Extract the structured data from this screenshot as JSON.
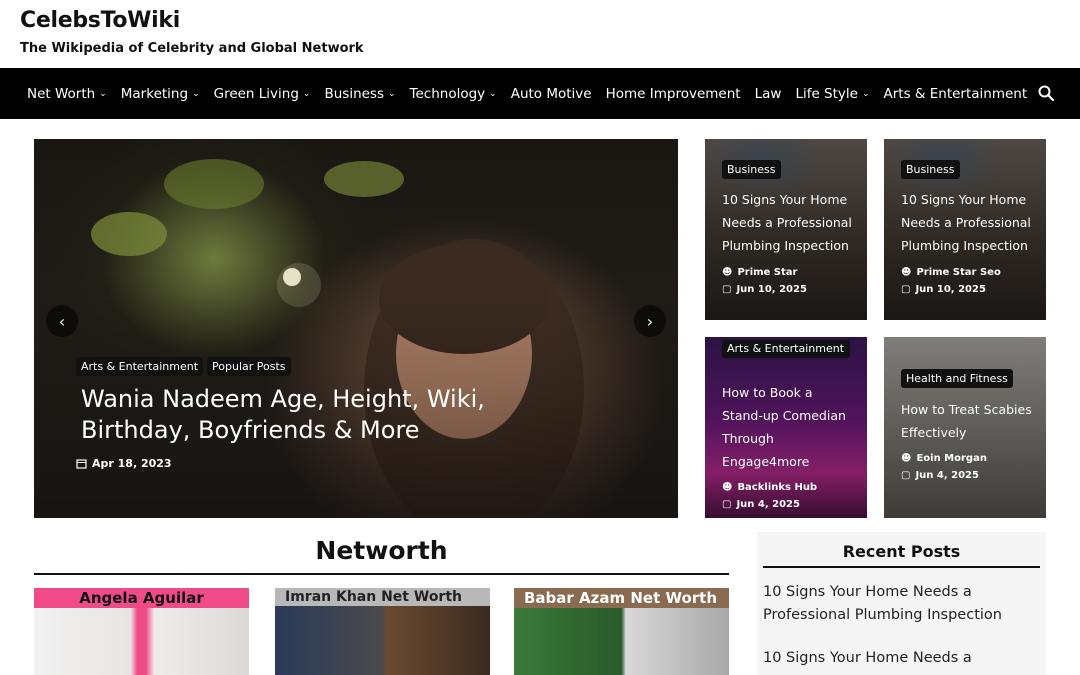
{
  "site": {
    "title": "CelebsToWiki",
    "tagline": "The Wikipedia of Celebrity and Global Network"
  },
  "nav": {
    "items": [
      {
        "label": "Net Worth",
        "dropdown": true
      },
      {
        "label": "Marketing",
        "dropdown": true
      },
      {
        "label": "Green Living",
        "dropdown": true
      },
      {
        "label": "Business",
        "dropdown": true
      },
      {
        "label": "Technology",
        "dropdown": true
      },
      {
        "label": "Auto Motive",
        "dropdown": false
      },
      {
        "label": "Home Improvement",
        "dropdown": false
      },
      {
        "label": "Law",
        "dropdown": false
      },
      {
        "label": "Life Style",
        "dropdown": true
      },
      {
        "label": "Arts & Entertainment",
        "dropdown": false
      }
    ],
    "search_icon": "search-icon"
  },
  "hero": {
    "tags": [
      "Arts & Entertainment",
      "Popular Posts"
    ],
    "title": "Wania Nadeem Age, Height, Wiki, Birthday, Boyfriends & More",
    "date": "Apr 18, 2023",
    "prev_icon": "chevron-left-icon",
    "next_icon": "chevron-right-icon"
  },
  "cards": [
    {
      "category": "Business",
      "title": "10 Signs Your Home Needs a Professional Plumbing Inspection",
      "author": "Prime Star",
      "date": "Jun 10, 2025"
    },
    {
      "category": "Business",
      "title": "10 Signs Your Home Needs a Professional Plumbing Inspection",
      "author": "Prime Star Seo",
      "date": "Jun 10, 2025"
    },
    {
      "category": "Arts & Entertainment",
      "title": "How to Book a Stand-up Comedian Through Engage4more",
      "author": "Backlinks Hub",
      "date": "Jun 4, 2025"
    },
    {
      "category": "Health and Fitness",
      "title": "How to Treat Scabies Effectively",
      "author": "Eoin Morgan",
      "date": "Jun 4, 2025"
    }
  ],
  "section": {
    "title": "Networth",
    "thumbs": [
      {
        "caption": "Angela Aguilar"
      },
      {
        "caption": "Imran Khan Net Worth"
      },
      {
        "caption": "Babar Azam Net Worth"
      }
    ]
  },
  "recent": {
    "title": "Recent Posts",
    "items": [
      "10 Signs Your Home Needs a Professional Plumbing Inspection",
      "10 Signs Your Home Needs a"
    ]
  }
}
